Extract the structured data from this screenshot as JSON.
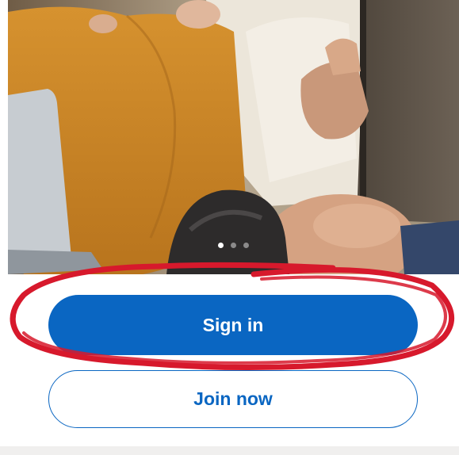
{
  "hero": {
    "image": "people-with-laptop-and-tablet-photo",
    "pager": {
      "total": 3,
      "active": 0
    }
  },
  "actions": {
    "sign_in_label": "Sign in",
    "join_now_label": "Join now"
  },
  "annotation": {
    "type": "hand-drawn-circle",
    "color": "#d7192c"
  },
  "colors": {
    "primary": "#0a66c2",
    "on_primary": "#ffffff",
    "annotation": "#d7192c",
    "footer": "#f0efee"
  }
}
